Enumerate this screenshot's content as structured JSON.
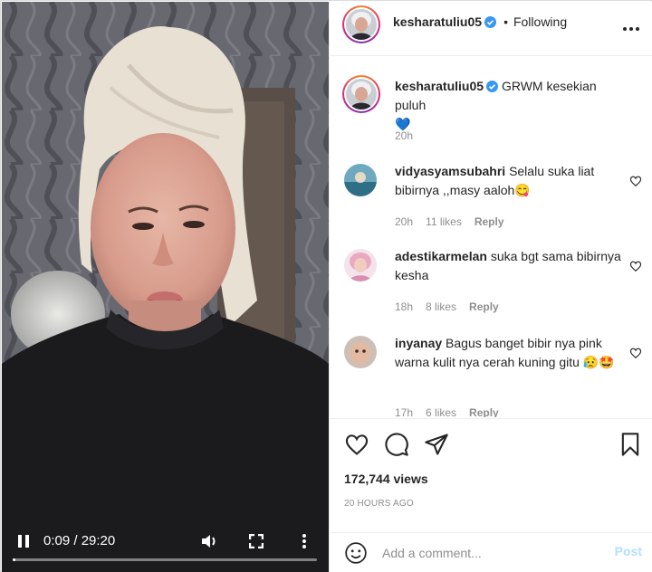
{
  "video": {
    "time_display": "0:09 / 29:20",
    "progress": 0.005,
    "icons": [
      "pause-icon",
      "volume-icon",
      "fullscreen-icon",
      "more-vertical-icon"
    ]
  },
  "post": {
    "author": "kesharatuliu05",
    "follow_separator": "•",
    "follow_status": "Following",
    "caption": "GRWM kesekian puluh",
    "caption_emoji": "💙",
    "caption_time": "20h",
    "views": "172,744 views",
    "posted_ago": "20 HOURS AGO"
  },
  "comments": [
    {
      "user": "vidyasyamsubahri",
      "text": "Selalu suka liat bibirnya ,,masy aaloh😋",
      "time": "20h",
      "likes": "11 likes",
      "reply": "Reply"
    },
    {
      "user": "adestikarmelan",
      "text": "suka bgt sama bibirnya kesha",
      "time": "18h",
      "likes": "8 likes",
      "reply": "Reply"
    },
    {
      "user": "inyanay",
      "text": "Bagus banget bibir nya pink warna kulit nya cerah kuning gitu 😥🤩",
      "time": "17h",
      "likes": "6 likes",
      "reply": "Reply"
    }
  ],
  "add_comment": {
    "placeholder": "Add a comment...",
    "post_label": "Post"
  },
  "colors": {
    "link_disabled": "#b2dffc",
    "meta_gray": "#8e8e8e",
    "verified_blue": "#3897f0"
  }
}
